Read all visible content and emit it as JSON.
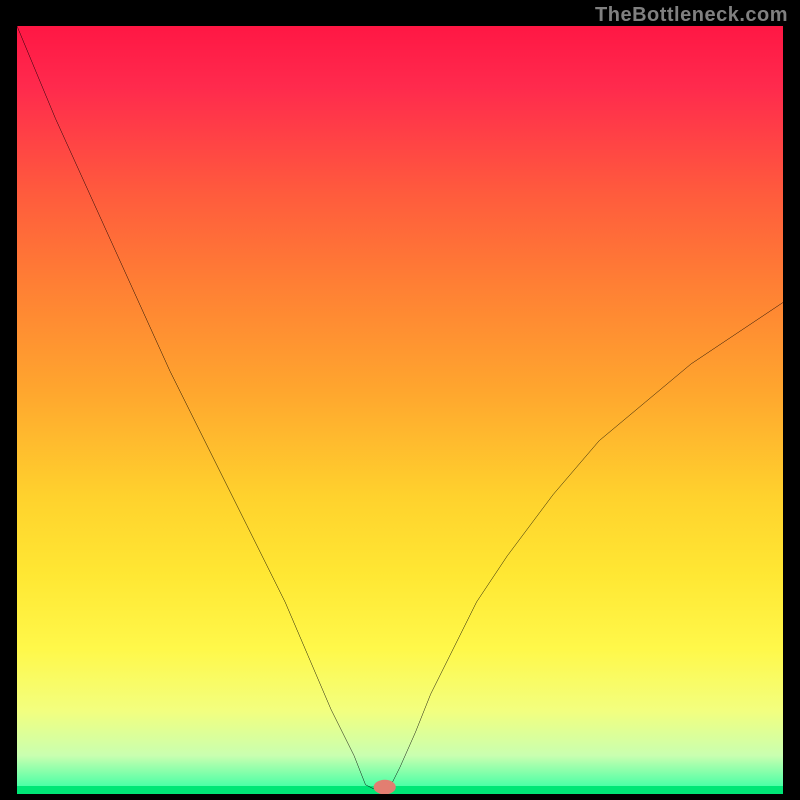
{
  "attribution": "TheBottleneck.com",
  "chart_data": {
    "type": "line",
    "title": "",
    "xlabel": "",
    "ylabel": "",
    "xlim": [
      0,
      100
    ],
    "ylim": [
      0,
      100
    ],
    "x": [
      0,
      5,
      10,
      15,
      20,
      25,
      30,
      35,
      38,
      41,
      44,
      45.5,
      46.5,
      48,
      49,
      50,
      52,
      54,
      57,
      60,
      64,
      70,
      76,
      82,
      88,
      94,
      100
    ],
    "y": [
      100,
      88,
      77,
      66,
      55,
      45,
      35,
      25,
      18,
      11,
      5,
      1.2,
      0.7,
      0.7,
      1.5,
      3.5,
      8,
      13,
      19,
      25,
      31,
      39,
      46,
      51,
      56,
      60,
      64
    ],
    "flat_segment": {
      "x_start": 45.5,
      "x_end": 49,
      "y": 0.7
    },
    "marker": {
      "x": 48,
      "y": 0.9,
      "color": "#e57373"
    },
    "gradient_colors": {
      "top": "#ff1744",
      "mid": "#ffd22d",
      "bottom": "#00e676"
    }
  }
}
